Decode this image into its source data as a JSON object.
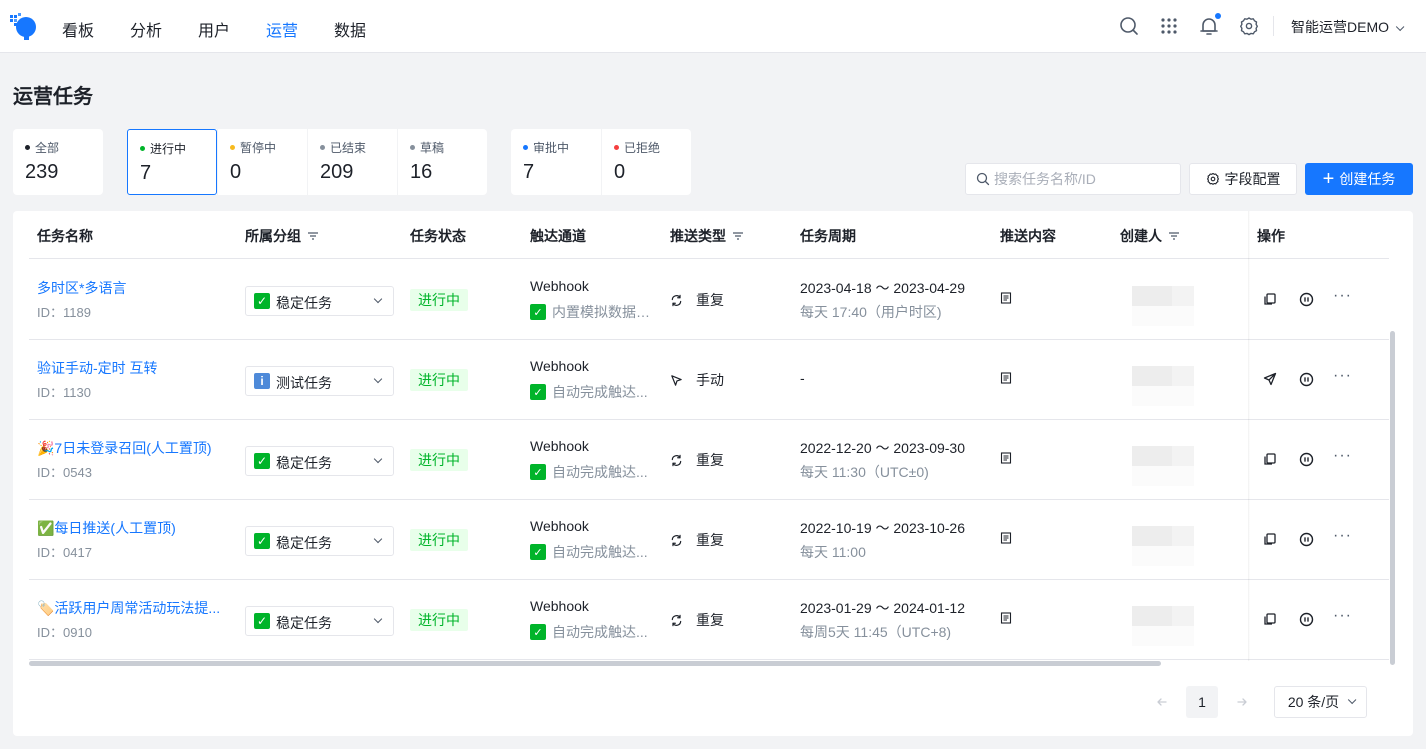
{
  "nav": {
    "items": [
      "看板",
      "分析",
      "用户",
      "运营",
      "数据"
    ],
    "active_index": 3,
    "org": "智能运营DEMO"
  },
  "page": {
    "title": "运营任务"
  },
  "stats": {
    "group1": [
      {
        "label": "全部",
        "count": "239",
        "dot": "#1d2129"
      }
    ],
    "group2": [
      {
        "label": "进行中",
        "count": "7",
        "dot": "#00b42a",
        "selected": true
      },
      {
        "label": "暂停中",
        "count": "0",
        "dot": "#f7ba1e"
      },
      {
        "label": "已结束",
        "count": "209",
        "dot": "#86909c"
      },
      {
        "label": "草稿",
        "count": "16",
        "dot": "#86909c"
      }
    ],
    "group3": [
      {
        "label": "审批中",
        "count": "7",
        "dot": "#1677ff"
      },
      {
        "label": "已拒绝",
        "count": "0",
        "dot": "#f53f3f"
      }
    ]
  },
  "toolbar": {
    "search_placeholder": "搜索任务名称/ID",
    "config_label": "字段配置",
    "create_label": "创建任务"
  },
  "table": {
    "headers": {
      "name": "任务名称",
      "group": "所属分组",
      "status": "任务状态",
      "channel": "触达通道",
      "push_type": "推送类型",
      "period": "任务周期",
      "content": "推送内容",
      "creator": "创建人",
      "ops": "操作"
    },
    "rows": [
      {
        "name": "多时区*多语言",
        "id": "ID：1189",
        "group": "稳定任务",
        "group_icon": "check",
        "status": "进行中",
        "channel": "Webhook",
        "channel_sub": "内置模拟数据(...",
        "push_type": "重复",
        "push_icon": "repeat",
        "period": "2023-04-18 ～ 2023-04-29",
        "period_sub": "每天 17:40（用户时区)",
        "op1": "copy"
      },
      {
        "name": "验证手动-定时 互转",
        "id": "ID：1130",
        "group": "测试任务",
        "group_icon": "info",
        "status": "进行中",
        "channel": "Webhook",
        "channel_sub": "自动完成触达...",
        "push_type": "手动",
        "push_icon": "cursor",
        "period": "-",
        "period_sub": "",
        "op1": "send"
      },
      {
        "name": "🎉7日未登录召回(人工置顶)",
        "id": "ID：0543",
        "group": "稳定任务",
        "group_icon": "check",
        "status": "进行中",
        "channel": "Webhook",
        "channel_sub": "自动完成触达...",
        "push_type": "重复",
        "push_icon": "repeat",
        "period": "2022-12-20 ～ 2023-09-30",
        "period_sub": "每天 11:30（UTC±0)",
        "op1": "copy"
      },
      {
        "name": "✅每日推送(人工置顶)",
        "id": "ID：0417",
        "group": "稳定任务",
        "group_icon": "check",
        "status": "进行中",
        "channel": "Webhook",
        "channel_sub": "自动完成触达...",
        "push_type": "重复",
        "push_icon": "repeat",
        "period": "2022-10-19 ～ 2023-10-26",
        "period_sub": "每天 11:00",
        "op1": "copy"
      },
      {
        "name": "🏷️活跃用户周常活动玩法提...",
        "id": "ID：0910",
        "group": "稳定任务",
        "group_icon": "check",
        "status": "进行中",
        "channel": "Webhook",
        "channel_sub": "自动完成触达...",
        "push_type": "重复",
        "push_icon": "repeat",
        "period": "2023-01-29 ～ 2024-01-12",
        "period_sub": "每周5天 11:45（UTC+8)",
        "op1": "copy"
      }
    ]
  },
  "pagination": {
    "current_page": "1",
    "page_size": "20 条/页"
  },
  "colors": {
    "accent": "#1677ff",
    "success": "#00b42a"
  }
}
